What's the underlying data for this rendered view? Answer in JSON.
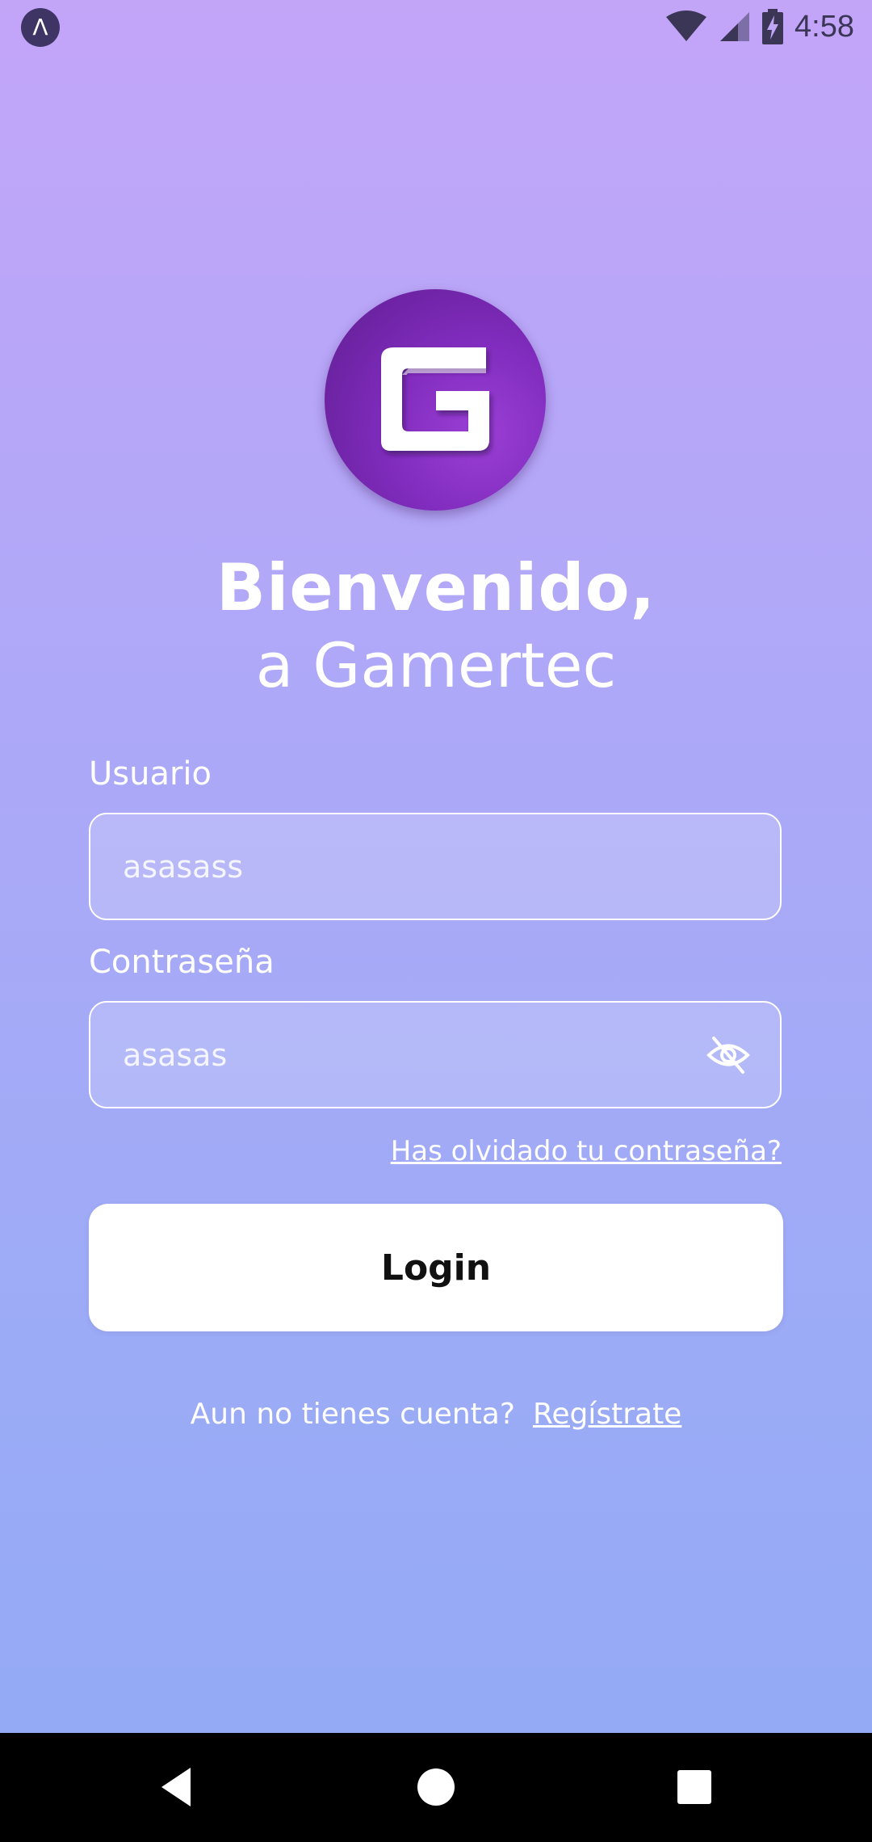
{
  "status_bar": {
    "time": "4:58",
    "app_icon": "expo-icon",
    "icons": [
      "wifi-icon",
      "signal-icon",
      "battery-charging-icon"
    ]
  },
  "logo": {
    "letter": "G",
    "colors": {
      "dark": "#5e1e8f",
      "light": "#9b3fd6"
    }
  },
  "welcome": {
    "line1": "Bienvenido,",
    "line2": "a Gamertec"
  },
  "form": {
    "username": {
      "label": "Usuario",
      "value": "asasass"
    },
    "password": {
      "label": "Contraseña",
      "value": "asasas",
      "toggle_icon": "eye-off-icon"
    },
    "forgot_link": "Has olvidado tu contraseña?",
    "login_button": "Login"
  },
  "register": {
    "prompt": "Aun no tienes cuenta?",
    "link": "Regístrate"
  },
  "nav": {
    "buttons": [
      "back-icon",
      "home-icon",
      "recents-icon"
    ]
  },
  "colors": {
    "gradient_top": "#c3a5f8",
    "gradient_bottom": "#94aaf5",
    "text": "#ffffff",
    "button_bg": "#ffffff"
  }
}
